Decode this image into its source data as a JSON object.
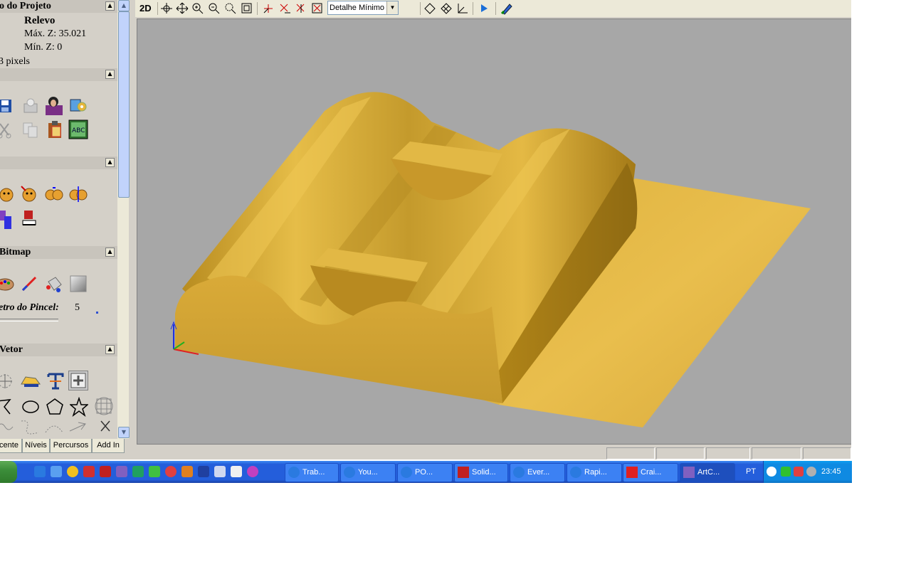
{
  "left_panel": {
    "project_section": {
      "title": "o do Projeto",
      "relief_label": "Relevo",
      "max_z": "Máx. Z: 35.021",
      "min_z": "Mín. Z: 0",
      "size_text": "3 pixels"
    },
    "bitmap_section": {
      "title": "Bitmap",
      "brush_label": "etro do Pincel:",
      "brush_value": "5"
    },
    "vector_section": {
      "title": "Vetor"
    },
    "tabs": [
      "cente",
      "Níveis",
      "Percursos",
      "Add In"
    ],
    "collapse_glyph": "▲"
  },
  "toolbar": {
    "mode_label": "2D",
    "detail_select": "Detalhe Mínimo"
  },
  "taskbar": {
    "tasks": [
      {
        "label": "Trab...",
        "icon": "ie-icon"
      },
      {
        "label": "You...",
        "icon": "ie-icon"
      },
      {
        "label": "PO...",
        "icon": "ie-icon"
      },
      {
        "label": "Solid...",
        "icon": "solidworks-icon"
      },
      {
        "label": "Ever...",
        "icon": "ie-icon"
      },
      {
        "label": "Rapi...",
        "icon": "ie-icon"
      },
      {
        "label": "Crai...",
        "icon": "pdf-icon"
      },
      {
        "label": "ArtC...",
        "icon": "artcam-icon"
      }
    ],
    "language": "PT",
    "clock": "23:45"
  },
  "colors": {
    "viewport_bg": "#a7a7a7",
    "model_gold": "#d7aa35",
    "panel_bg": "#d4d0c8",
    "taskbar_blue": "#245edb"
  }
}
